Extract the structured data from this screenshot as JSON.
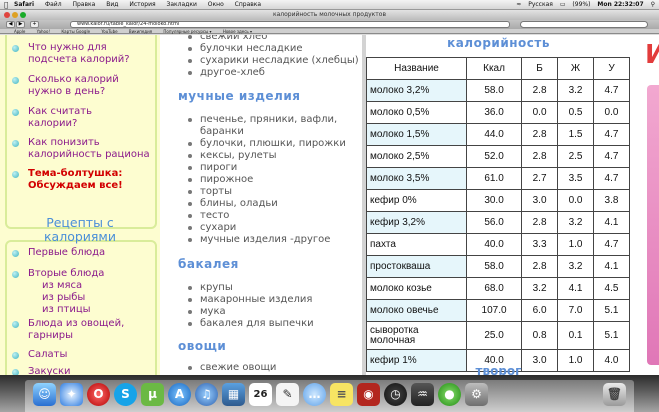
{
  "menubar": {
    "app": "Safari",
    "menus": [
      "Файл",
      "Правка",
      "Вид",
      "История",
      "Закладки",
      "Окно",
      "Справка"
    ],
    "language": "Русская",
    "battery": "(99%)",
    "clock": "Mon 22:32:07"
  },
  "window": {
    "title": "калорийность молочных продуктов",
    "url": "www.kalor.ru/table_kalor/24-moloko.html",
    "bookmarks": [
      "Apple",
      "Yahoo!",
      "Карты Google",
      "YouTube",
      "Википедия",
      "Популярные ресурсы ▾",
      "Новое здесь ▾"
    ]
  },
  "sidebar": {
    "links": [
      "Что нужно для подсчета калорий?",
      "Сколько калорий нужно в день?",
      "Как считать калории?",
      "Как понизить калорийность рациона"
    ],
    "forum_link": "Тема-болтушка: Обсуждаем все!",
    "recipes_heading": "Рецепты с калориями",
    "recipes": {
      "first": "Первые блюда",
      "second": "Вторые блюда",
      "meat": "из мяса",
      "fish": "из рыбы",
      "bird": "из птицы",
      "veg": "Блюда из овощей, гарниры",
      "salads": "Салаты",
      "snacks": "Закуски"
    }
  },
  "middle": {
    "bread_items": [
      "свежий хлеб",
      "булочки несладкие",
      "сухарики несладкие (хлебцы)",
      "другое-хлеб"
    ],
    "flour_heading": "мучные изделия",
    "flour_items": [
      "печенье, пряники, вафли,",
      "баранки",
      "булочки, плюшки, пирожки",
      "кексы, рулеты",
      "пироги",
      "пирожное",
      "торты",
      "блины, оладьи",
      "тесто",
      "сухари",
      "мучные изделия -другое"
    ],
    "grocery_heading": "бакалея",
    "grocery_items": [
      "крупы",
      "макаронные изделия",
      "мука",
      "бакалея для выпечки"
    ],
    "veg_heading": "овощи",
    "veg_items": [
      "свежие овощи"
    ]
  },
  "table": {
    "heading": "калорийность",
    "columns": [
      "Название",
      "Ккал",
      "Б",
      "Ж",
      "У"
    ],
    "rows": [
      [
        "молоко 3,2%",
        "58.0",
        "2.8",
        "3.2",
        "4.7"
      ],
      [
        "молоко 0,5%",
        "36.0",
        "0.0",
        "0.5",
        "0.0"
      ],
      [
        "молоко 1,5%",
        "44.0",
        "2.8",
        "1.5",
        "4.7"
      ],
      [
        "молоко 2,5%",
        "52.0",
        "2.8",
        "2.5",
        "4.7"
      ],
      [
        "молоко 3,5%",
        "61.0",
        "2.7",
        "3.5",
        "4.7"
      ],
      [
        "кефир 0%",
        "30.0",
        "3.0",
        "0.0",
        "3.8"
      ],
      [
        "кефир 3,2%",
        "56.0",
        "2.8",
        "3.2",
        "4.1"
      ],
      [
        "пахта",
        "40.0",
        "3.3",
        "1.0",
        "4.7"
      ],
      [
        "простокваша",
        "58.0",
        "2.8",
        "3.2",
        "4.1"
      ],
      [
        "молоко козье",
        "68.0",
        "3.2",
        "4.1",
        "4.5"
      ],
      [
        "молоко овечье",
        "107.0",
        "6.0",
        "7.0",
        "5.1"
      ],
      [
        "сыворотка молочная",
        "25.0",
        "0.8",
        "0.1",
        "5.1"
      ],
      [
        "кефир 1%",
        "40.0",
        "3.0",
        "1.0",
        "4.0"
      ]
    ],
    "next_heading": "творог"
  },
  "colors": {
    "link": "#8b1a8b",
    "link_alert": "#d20000",
    "heading": "#5d8fd6",
    "sidebar_bg": "#fdfdd0",
    "table_odd_row": "#e6f6fb"
  },
  "dock": {
    "icons": [
      "finder-icon",
      "safari-icon",
      "opera-icon",
      "skype-icon",
      "utorrent-icon",
      "app-store-icon",
      "itunes-icon",
      "photo-icon",
      "calendar-icon",
      "textedit-icon",
      "messages-icon",
      "stickies-icon",
      "photobooth-icon",
      "dashboard-icon",
      "system-monitor-icon",
      "utilities-icon",
      "preferences-icon",
      "trash-icon"
    ],
    "calendar_day": "26"
  }
}
